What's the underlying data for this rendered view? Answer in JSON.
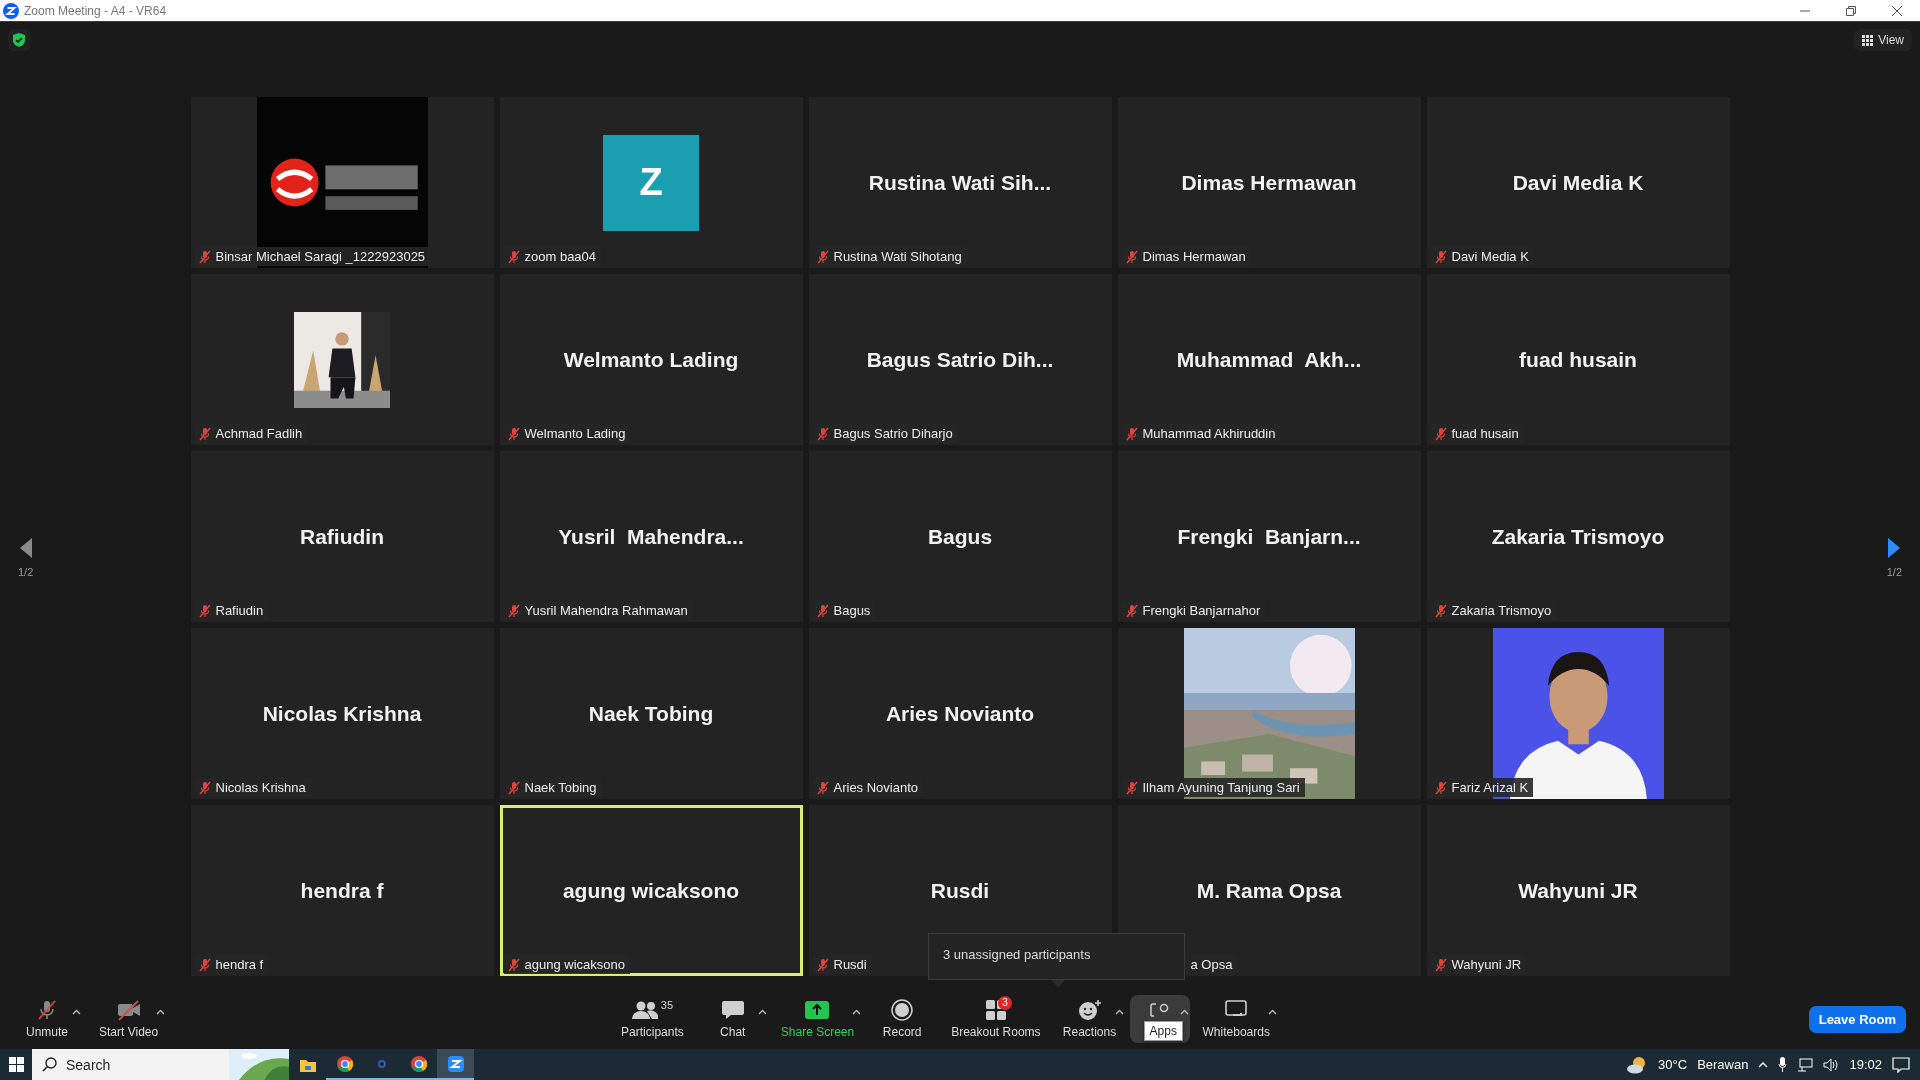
{
  "window": {
    "title": "Zoom Meeting - A4 - VR64"
  },
  "view_button": {
    "label": "View"
  },
  "pager": {
    "left": {
      "label": "1/2",
      "enabled": false
    },
    "right": {
      "label": "1/2",
      "enabled": true
    }
  },
  "tiles": [
    {
      "kind": "picture",
      "name": "Binsar Michael Saragi _1222923025",
      "muted": true,
      "speaking": false
    },
    {
      "kind": "avatar",
      "letter": "Z",
      "color": "#1a9fb0",
      "name": "zoom baa04",
      "muted": true,
      "speaking": false
    },
    {
      "kind": "name",
      "display": "Rustina Wati Sih...",
      "name": "Rustina Wati Sihotang",
      "muted": true,
      "speaking": false
    },
    {
      "kind": "name",
      "display": "Dimas Hermawan",
      "name": "Dimas Hermawan",
      "muted": true,
      "speaking": false
    },
    {
      "kind": "name",
      "display": "Davi Media K",
      "name": "Davi Media K",
      "muted": true,
      "speaking": false
    },
    {
      "kind": "picture",
      "name": "Achmad Fadlih",
      "muted": true,
      "speaking": false
    },
    {
      "kind": "name",
      "display": "Welmanto Lading",
      "name": "Welmanto Lading",
      "muted": true,
      "speaking": false
    },
    {
      "kind": "name",
      "display": "Bagus Satrio Dih...",
      "name": "Bagus Satrio Diharjo",
      "muted": true,
      "speaking": false
    },
    {
      "kind": "name",
      "display": "Muhammad  Akh...",
      "name": "Muhammad Akhiruddin",
      "muted": true,
      "speaking": false
    },
    {
      "kind": "name",
      "display": "fuad husain",
      "name": "fuad husain",
      "muted": true,
      "speaking": false
    },
    {
      "kind": "name",
      "display": "Rafiudin",
      "name": "Rafiudin",
      "muted": true,
      "speaking": false
    },
    {
      "kind": "name",
      "display": "Yusril  Mahendra...",
      "name": "Yusril Mahendra Rahmawan",
      "muted": true,
      "speaking": false
    },
    {
      "kind": "name",
      "display": "Bagus",
      "name": "Bagus",
      "muted": true,
      "speaking": false
    },
    {
      "kind": "name",
      "display": "Frengki  Banjarn...",
      "name": "Frengki Banjarnahor",
      "muted": true,
      "speaking": false
    },
    {
      "kind": "name",
      "display": "Zakaria Trismoyo",
      "name": "Zakaria Trismoyo",
      "muted": true,
      "speaking": false
    },
    {
      "kind": "name",
      "display": "Nicolas Krishna",
      "name": "Nicolas Krishna",
      "muted": true,
      "speaking": false
    },
    {
      "kind": "name",
      "display": "Naek Tobing",
      "name": "Naek Tobing",
      "muted": true,
      "speaking": false
    },
    {
      "kind": "name",
      "display": "Aries Novianto",
      "name": "Aries Novianto",
      "muted": true,
      "speaking": false
    },
    {
      "kind": "picture",
      "name": "Ilham Ayuning Tanjung Sari",
      "muted": true,
      "speaking": false
    },
    {
      "kind": "picture",
      "name": "Fariz Arizal K",
      "muted": true,
      "speaking": false
    },
    {
      "kind": "name",
      "display": "hendra f",
      "name": "hendra f",
      "muted": true,
      "speaking": false
    },
    {
      "kind": "name",
      "display": "agung wicaksono",
      "name": "agung wicaksono",
      "muted": true,
      "speaking": true
    },
    {
      "kind": "name",
      "display": "Rusdi",
      "name": "Rusdi",
      "muted": true,
      "speaking": false
    },
    {
      "kind": "name",
      "display": "M. Rama Opsa",
      "name": "a Opsa",
      "muted": false,
      "covered": true,
      "speaking": false
    },
    {
      "kind": "name",
      "display": "Wahyuni JR",
      "name": "Wahyuni JR",
      "muted": true,
      "speaking": false
    }
  ],
  "tooltip": {
    "text": "3 unassigned participants"
  },
  "toolbar": {
    "left": [
      {
        "kind": "mic",
        "label": "Unmute",
        "caret": true
      },
      {
        "kind": "video",
        "label": "Start Video",
        "caret": true
      }
    ],
    "center": [
      {
        "kind": "participants",
        "label": "Participants",
        "count": "35",
        "caret": false
      },
      {
        "kind": "chat",
        "label": "Chat",
        "caret": true
      },
      {
        "kind": "share",
        "label": "Share Screen",
        "caret": true
      },
      {
        "kind": "record",
        "label": "Record",
        "caret": false
      },
      {
        "kind": "breakout",
        "label": "Breakout Rooms",
        "badge": "3",
        "caret": false
      },
      {
        "kind": "reactions",
        "label": "Reactions",
        "caret": true
      },
      {
        "kind": "apps",
        "tooltip": "Apps",
        "highlighted": true,
        "caret": true
      },
      {
        "kind": "whiteboards",
        "label": "Whiteboards",
        "caret": true
      }
    ],
    "leave_button": {
      "label": "Leave Room"
    }
  },
  "taskbar": {
    "search": {
      "placeholder": "Search"
    },
    "apps": [
      {
        "kind": "explorer",
        "running": false,
        "active": false
      },
      {
        "kind": "chrome",
        "running": true,
        "active": false
      },
      {
        "kind": "camera",
        "running": true,
        "active": false
      },
      {
        "kind": "chrome",
        "running": true,
        "active": false
      },
      {
        "kind": "zoom",
        "running": true,
        "active": true
      }
    ],
    "weather": {
      "temp": "30°C",
      "condition": "Berawan"
    },
    "clock": "19:02"
  }
}
